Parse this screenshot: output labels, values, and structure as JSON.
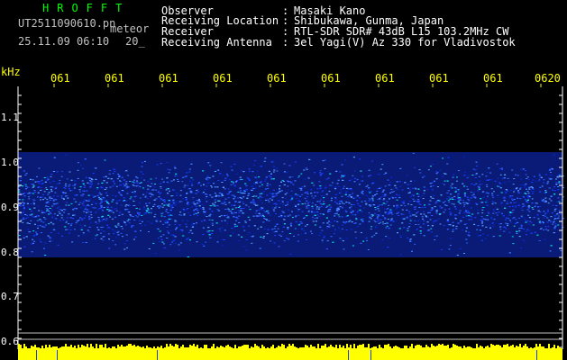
{
  "header": {
    "logo": "HROFFT",
    "filename": "UT2511090610.pn",
    "filename_suffix": "meteor",
    "datetime": "25.11.09 06:10",
    "interval": "20_",
    "fields": [
      {
        "label": "Observer",
        "value": "Masaki Kano"
      },
      {
        "label": "Receiving Location",
        "value": "Shibukawa, Gunma, Japan"
      },
      {
        "label": "Receiver",
        "value": "RTL-SDR SDR# 43dB L15 103.2MHz CW"
      },
      {
        "label": "Receiving Antenna",
        "value": "3el Yagi(V) Az 330 for Vladivostok"
      }
    ]
  },
  "axis": {
    "unit_label": "kHz",
    "time_ticks": [
      "061",
      "061",
      "061",
      "061",
      "061",
      "061",
      "061",
      "061",
      "061",
      "0620"
    ],
    "freq_ticks": [
      "1.1",
      "1.0",
      "0.9",
      "0.8",
      "0.7",
      "0.6"
    ]
  },
  "colors": {
    "background": "#000000",
    "logo": "#00ff00",
    "axis_text": "#ffff00",
    "info_text": "#ffffff",
    "noise_band": "#1a3cff",
    "noise_highlight": "#00e0e0",
    "strip": "#ffff00"
  }
}
